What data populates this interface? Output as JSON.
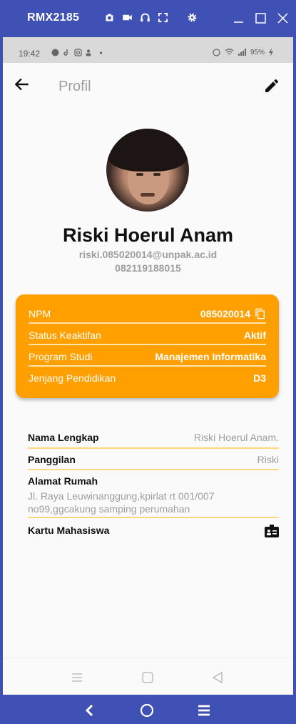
{
  "emulator": {
    "title": "RMX2185",
    "icons": [
      "camera-icon",
      "video-icon",
      "headphones-icon",
      "fullscreen-icon",
      "settings-icon"
    ],
    "window_buttons": [
      "minimize-icon",
      "maximize-icon",
      "close-icon"
    ]
  },
  "statusbar": {
    "time": "19:42",
    "battery": "95%"
  },
  "appbar": {
    "title": "Profil"
  },
  "profile": {
    "name": "Riski Hoerul Anam",
    "email": "riski.085020014@unpak.ac.id",
    "phone": "082119188015"
  },
  "card": {
    "rows": [
      {
        "label": "NPM",
        "value": "085020014"
      },
      {
        "label": "Status Keaktifan",
        "value": "Aktif"
      },
      {
        "label": "Program Studi",
        "value": "Manajemen Informatika"
      },
      {
        "label": "Jenjang Pendidikan",
        "value": "D3"
      }
    ],
    "color": "#ff9f00"
  },
  "details": {
    "full_name_label": "Nama Lengkap",
    "full_name_value": "Riski Hoerul Anam.",
    "nickname_label": "Panggilan",
    "nickname_value": "Riski",
    "address_label": "Alamat Rumah",
    "address_value": "Jl. Raya Leuwinanggung,kpirlat rt 001/007 no99,ggcakung samping perumahan",
    "student_card_label": "Kartu Mahasiswa"
  },
  "colors": {
    "accent": "#ff9f00",
    "emulator": "#3f51b5"
  }
}
